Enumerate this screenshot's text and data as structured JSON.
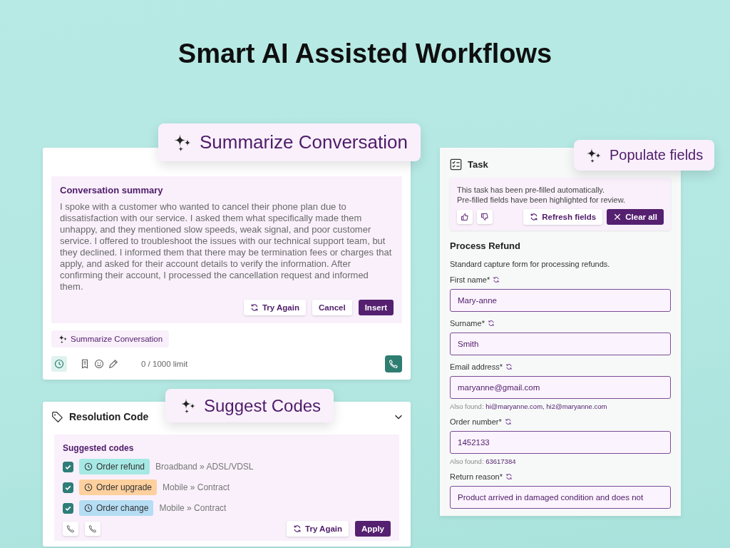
{
  "title": "Smart AI Assisted Workflows",
  "callouts": [
    {
      "label": "Summarize Conversation"
    },
    {
      "label": "Suggest Codes"
    },
    {
      "label": "Populate fields"
    }
  ],
  "conversation_card": {
    "summary_title": "Conversation summary",
    "summary_text": "I spoke with a customer who wanted to cancel their phone plan due to dissatisfaction with our service. I asked them what specifically made them unhappy, and they mentioned slow speeds, weak signal, and poor customer service. I offered to troubleshoot the issues with our technical support team, but they declined. I informed them that there may be termination fees or charges that apply, and asked for their account details to verify the information. After confirming their account, I processed the cancellation request and informed them.",
    "actions": [
      {
        "label": "Try Again",
        "kind": "retry"
      },
      {
        "label": "Cancel",
        "kind": "secondary"
      },
      {
        "label": "Insert",
        "kind": "primary"
      }
    ],
    "ai_chip": "Summarize Conversation",
    "char_count": "0 / 1000 limit"
  },
  "resolution_card": {
    "title": "Resolution Code",
    "expanded": true,
    "suggestions_title": "Suggested codes",
    "codes": [
      {
        "label": "Order refund",
        "path": "Broadband » ADSL/VDSL",
        "checked": true,
        "color": "#a6e9e4"
      },
      {
        "label": "Order upgrade",
        "path": "Mobile » Contract",
        "checked": true,
        "color": "#fdd09e"
      },
      {
        "label": "Order change",
        "path": "Mobile » Contract",
        "checked": true,
        "color": "#b5ddf4"
      }
    ],
    "actions": [
      {
        "label": "Try Again",
        "kind": "retry"
      },
      {
        "label": "Apply",
        "kind": "primary"
      }
    ]
  },
  "task_panel": {
    "title": "Task",
    "notice_lines": [
      "This task has been pre-filled automatically.",
      "Pre-filled fields have been highlighted for review."
    ],
    "actions": [
      {
        "label": "Refresh fields",
        "kind": "retry"
      },
      {
        "label": "Clear all",
        "kind": "clear"
      }
    ],
    "form_title": "Process Refund",
    "form_description": "Standard capture form for processing refunds.",
    "fields": [
      {
        "label": "First name*",
        "value": "Mary-anne"
      },
      {
        "label": "Surname*",
        "value": "Smith"
      },
      {
        "label": "Email address*",
        "value": "maryanne@gmail.com",
        "also_found_label": "Also found:",
        "also_found": "hi@maryanne.com, hi2@maryanne.com"
      },
      {
        "label": "Order number*",
        "value": "1452133",
        "also_found_label": "Also found:",
        "also_found": "63617384"
      },
      {
        "label": "Return reason*",
        "value": "Product arrived in damaged condition and does not"
      }
    ]
  }
}
